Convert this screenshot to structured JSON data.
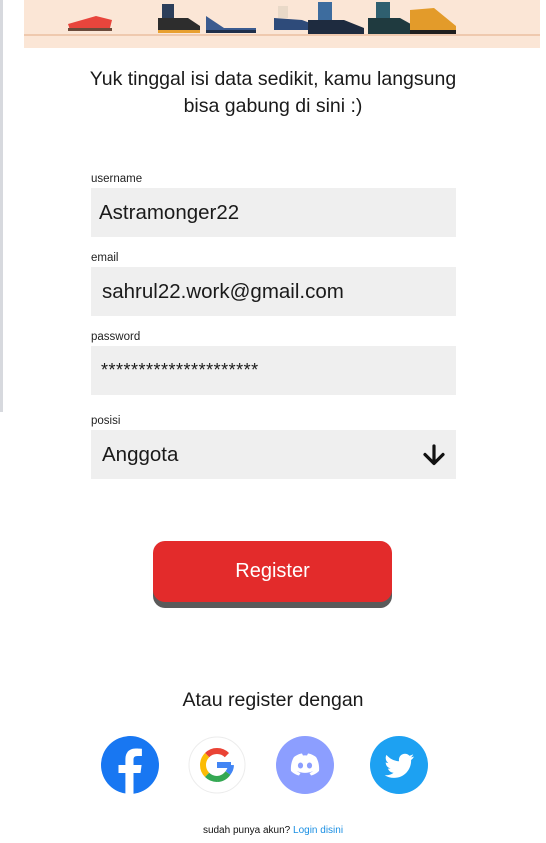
{
  "intro": {
    "line1": "Yuk tinggal isi data sedikit, kamu langsung",
    "line2": "bisa gabung di sini :)"
  },
  "form": {
    "username": {
      "label": "username",
      "value": "Astramonger22"
    },
    "email": {
      "label": "email",
      "value": "sahrul22.work@gmail.com"
    },
    "password": {
      "label": "password",
      "value": "*********************"
    },
    "posisi": {
      "label": "posisi",
      "selected": "Anggota"
    }
  },
  "register_button": {
    "label": "Register"
  },
  "alt_register": {
    "title": "Atau register dengan",
    "providers": [
      "facebook",
      "google",
      "discord",
      "twitter"
    ]
  },
  "footer": {
    "prompt": "sudah punya akun?",
    "link": "Login disini"
  },
  "colors": {
    "primary_red": "#e32b2b",
    "field_bg": "#efefef",
    "banner_bg": "#fbe6d6",
    "link_blue": "#1a8fe3",
    "facebook": "#1877f2",
    "discord": "#8c9eff",
    "twitter": "#1da1f2"
  }
}
